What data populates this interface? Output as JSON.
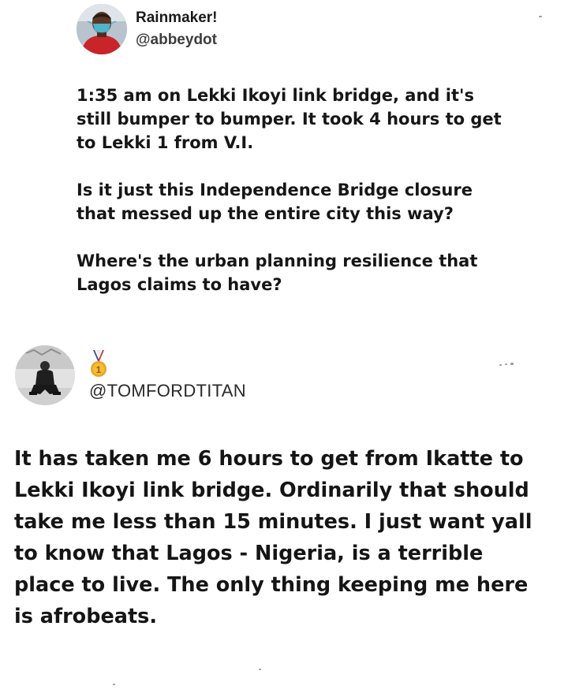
{
  "tweet1": {
    "display_name": "Rainmaker!",
    "handle": "@abbeydot",
    "avatar_icon": "profile-photo-masked-man",
    "paragraphs": [
      "1:35 am on Lekki Ikoyi link bridge, and it's\nstill bumper to bumper. It took 4 hours to get\nto Lekki 1 from V.I.",
      "Is it just this Independence Bridge closure\nthat messed up the entire city this way?",
      "Where's the urban planning resilience that\nLagos claims to have?"
    ]
  },
  "tweet2": {
    "handle": "@TOMFORDTITAN",
    "avatar_icon": "profile-photo-seated-man",
    "badge_icon": "gold-medal-icon",
    "badge_label": "1",
    "body": "It has taken me 6 hours to get from Ikatte to Lekki Ikoyi link bridge. Ordinarily that should take me less than 15 minutes. I just want yall to know that Lagos - Nigeria, is a terrible place to live. The only thing keeping me here is afrobeats."
  },
  "colors": {
    "background": "#ffffff",
    "text": "#161616",
    "handle_text": "#3d3d3d",
    "medal_gold": "#e9a520",
    "medal_ribbon": "#3b4a8c"
  }
}
